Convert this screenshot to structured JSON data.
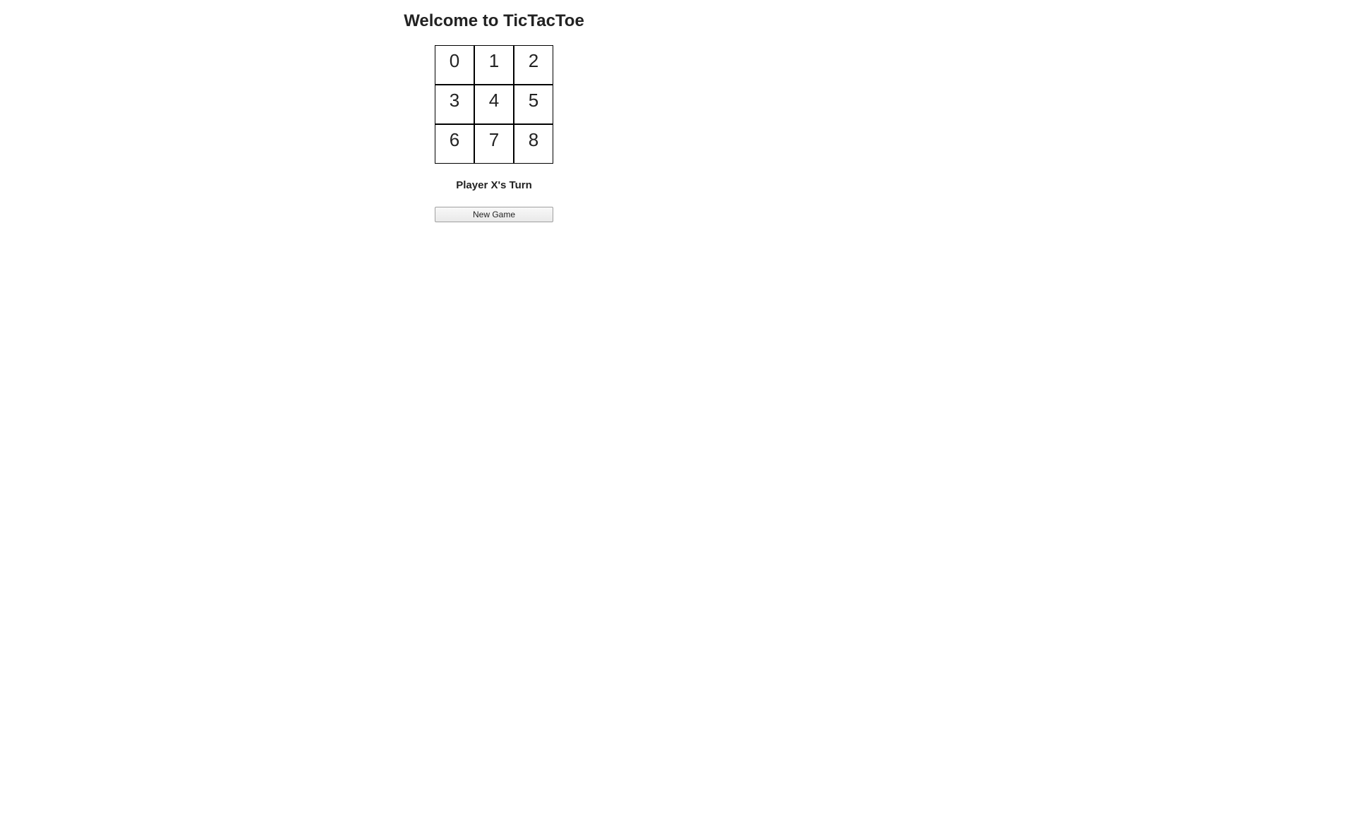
{
  "header": {
    "title": "Welcome to TicTacToe"
  },
  "board": {
    "cells": [
      "0",
      "1",
      "2",
      "3",
      "4",
      "5",
      "6",
      "7",
      "8"
    ]
  },
  "status": {
    "text": "Player X's Turn"
  },
  "controls": {
    "new_game_label": "New Game"
  }
}
